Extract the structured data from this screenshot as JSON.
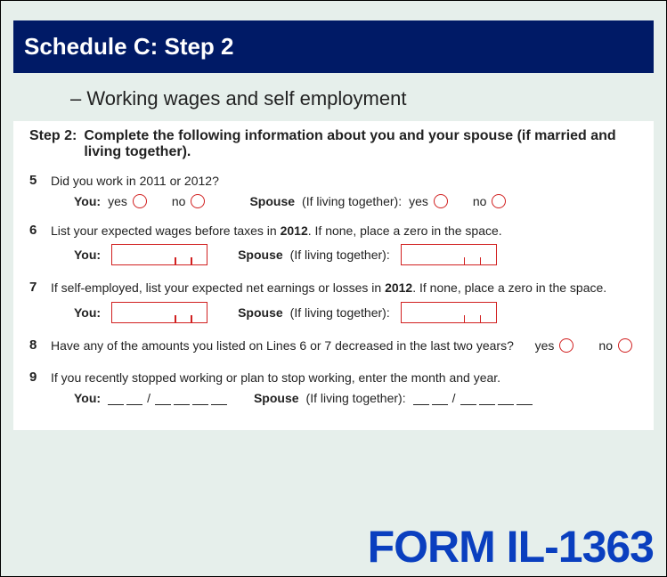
{
  "header": {
    "title": "Schedule C: Step 2",
    "subtitle": "– Working wages and self employment"
  },
  "step": {
    "label": "Step 2:",
    "instruction": "Complete the following information about you and your spouse (if married and living together)."
  },
  "labels": {
    "you": "You:",
    "spouse": "Spouse",
    "spouse_paren": "(If living together):",
    "yes": "yes",
    "no": "no"
  },
  "q5": {
    "num": "5",
    "text": "Did you work in 2011 or 2012?"
  },
  "q6": {
    "num": "6",
    "text_a": "List your expected wages before taxes in ",
    "bold": "2012",
    "text_b": ".  If none, place a zero in the space."
  },
  "q7": {
    "num": "7",
    "text_a": "If self-employed, list your expected net earnings or losses in ",
    "bold": "2012",
    "text_b": ".  If none, place a zero in the space."
  },
  "q8": {
    "num": "8",
    "text": "Have any of the amounts you listed on Lines 6 or 7 decreased in the last two years?"
  },
  "q9": {
    "num": "9",
    "text": "If you recently stopped working or plan to stop working, enter the month and year."
  },
  "footer": {
    "form": "FORM IL-1363"
  }
}
